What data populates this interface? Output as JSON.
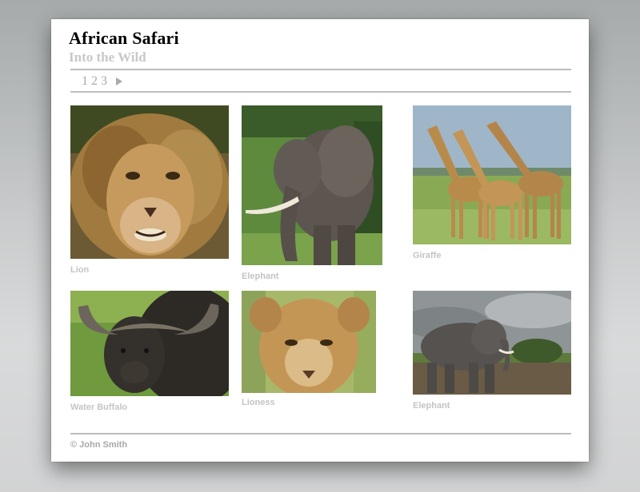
{
  "site": {
    "title": "African Safari",
    "subtitle": "Into the Wild"
  },
  "pagination": {
    "pages": [
      "1",
      "2",
      "3"
    ],
    "next_icon": "triangle-right"
  },
  "gallery": {
    "items": [
      {
        "caption": "Lion",
        "image": "lion"
      },
      {
        "caption": "Elephant",
        "image": "elephant"
      },
      {
        "caption": "Giraffe",
        "image": "giraffes"
      },
      {
        "caption": "Water Buffalo",
        "image": "water-buffalo"
      },
      {
        "caption": "Lioness",
        "image": "lioness"
      },
      {
        "caption": "Elephant",
        "image": "elephant"
      }
    ]
  },
  "footer": {
    "copyright": "© John Smith"
  },
  "colors": {
    "card_background": "#ffffff",
    "caption_text": "#c4c4c4",
    "subtitle_text": "#c8c8c8",
    "rule": "#bdbdbd"
  }
}
